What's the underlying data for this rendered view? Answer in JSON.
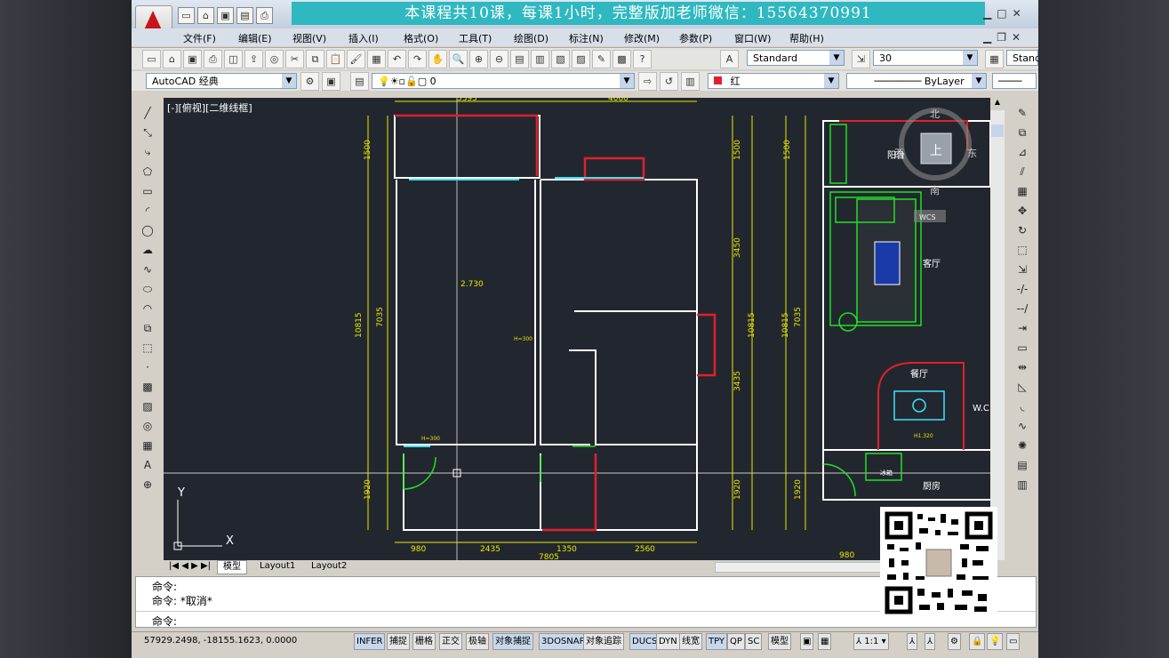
{
  "banner": "本课程共10课，每课1小时，完整版加老师微信：15564370991",
  "menus": [
    "文件(F)",
    "编辑(E)",
    "视图(V)",
    "插入(I)",
    "格式(O)",
    "工具(T)",
    "绘图(D)",
    "标注(N)",
    "修改(M)",
    "参数(P)",
    "窗口(W)",
    "帮助(H)"
  ],
  "toolbar": {
    "text_style": "Standard",
    "dim_value": "30",
    "table_style": "Standa",
    "workspace": "AutoCAD 经典",
    "layer": "0",
    "color": "红",
    "linetype": "ByLayer"
  },
  "viewport_label": "[-][俯视][二维线框]",
  "plan_labels": {
    "dim_top1": "5395",
    "dim_top2": "4060",
    "dim_1500a": "1500",
    "dim_10815": "10815",
    "dim_7035": "7035",
    "dim_1920": "1920",
    "dim_3450": "3450",
    "dim_3435": "3435",
    "dim_980": "980",
    "dim_2435": "2435",
    "dim_1350": "1350",
    "dim_2560": "2560",
    "dim_7805": "7805",
    "height_label": "2.730",
    "h_label_1": "H=300",
    "h_label_2": "H=300",
    "north": "北",
    "south": "南",
    "west": "西",
    "east": "东",
    "up": "上",
    "balcony": "阳台",
    "living": "客厅",
    "dining": "餐厅",
    "kitchen": "厨房",
    "wc": "W.C",
    "dining_h": "H1.320",
    "kitchen_tag": "冰箱",
    "wcs_label": "WCS",
    "axis_y": "Y",
    "axis_x": "X"
  },
  "tabs": [
    "模型",
    "Layout1",
    "Layout2"
  ],
  "command": {
    "line1": "命令:",
    "line2": "命令: *取消*",
    "prompt": "命令:"
  },
  "status": {
    "coords": "57929.2498, -18155.1623, 0.0000",
    "buttons": [
      "INFER",
      "捕捉",
      "栅格",
      "正交",
      "极轴",
      "对象捕捉",
      "3DOSNAP",
      "对象追踪",
      "DUCS",
      "DYN",
      "线宽",
      "TPY",
      "QP",
      "SC"
    ],
    "model": "模型",
    "scale": "1:1"
  },
  "colors": {
    "canvas": "#22272f",
    "wall": "#ffffff",
    "red": "#e0202a",
    "cyan": "#3fe0ff",
    "yellow": "#e8e800",
    "green": "#22e022",
    "banner": "#2fb8c0"
  }
}
